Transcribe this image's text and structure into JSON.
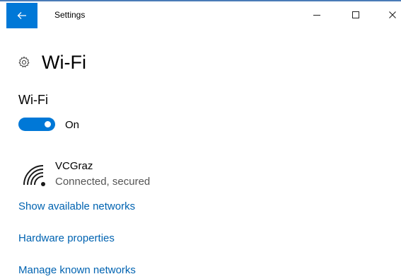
{
  "window": {
    "title": "Settings",
    "controls": {
      "minimize": "minimize-icon",
      "maximize": "maximize-icon",
      "close": "close-icon"
    }
  },
  "header": {
    "back_icon": "back-arrow-icon",
    "page_icon": "gear-icon",
    "page_title": "Wi-Fi"
  },
  "wifi_section": {
    "title": "Wi-Fi",
    "toggle": {
      "state_label": "On",
      "on": true,
      "accent": "#0078d7"
    }
  },
  "network": {
    "icon": "wifi-signal-icon",
    "name": "VCGraz",
    "status": "Connected, secured"
  },
  "links": [
    {
      "label": "Show available networks"
    },
    {
      "label": "Hardware properties"
    },
    {
      "label": "Manage known networks"
    }
  ],
  "colors": {
    "accent": "#0078d7",
    "link": "#0063b1",
    "secondary_text": "#555555"
  }
}
